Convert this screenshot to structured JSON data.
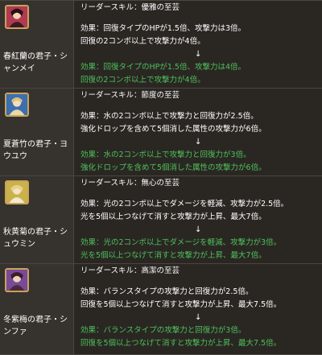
{
  "rows": [
    {
      "name": "春紅蘭の君子・シャンメイ",
      "skill_title": "リーダースキル：優雅の至芸",
      "before": [
        "効果：回復タイプのHPが1.5倍、攻撃力は3倍。",
        "回復の2コンボ以上で攻撃力が4倍。"
      ],
      "arrow": "↓",
      "after": [
        "効果：回復タイプのHPが1.5倍、攻撃力は4倍。",
        "回復の2コンボ以上で攻撃力が4倍。"
      ],
      "icon": "shanmei-portrait-icon",
      "frame_color": "#b03a52"
    },
    {
      "name": "夏蒼竹の君子・ヨウユウ",
      "skill_title": "リーダースキル：節度の至芸",
      "before": [
        "効果：水の2コンボ以上で攻撃力と回復力が2.5倍。",
        "強化ドロップを含めて5個消した属性の攻撃力が6倍。"
      ],
      "arrow": "↓",
      "after": [
        "効果：水の2コンボ以上で攻撃力と回復力が3倍。",
        "強化ドロップを含めて5個消した属性の攻撃力が6倍。"
      ],
      "icon": "youyuu-portrait-icon",
      "frame_color": "#3b6fb0"
    },
    {
      "name": "秋黄菊の君子・シュウミン",
      "skill_title": "リーダースキル：無心の至芸",
      "before": [
        "効果：光の2コンボ以上でダメージを軽減、攻撃力が2.5倍。",
        "光を5個以上つなげて消すと攻撃力が上昇、最大7倍。"
      ],
      "arrow": "↓",
      "after": [
        "効果：光の2コンボ以上でダメージを軽減、攻撃力が3倍。",
        "光を5個以上つなげて消すと攻撃力が上昇、最大7倍。"
      ],
      "icon": "shuumin-portrait-icon",
      "frame_color": "#c9b24a"
    },
    {
      "name": "冬紫梅の君子・シンファ",
      "skill_title": "リーダースキル：高潔の至芸",
      "before": [
        "効果：バランスタイプの攻撃力と回復力が2.5倍。",
        "回復を5個以上つなげて消すと攻撃力が上昇、最大7.5倍。"
      ],
      "arrow": "↓",
      "after": [
        "効果：バランスタイプの攻撃力と回復力が3倍。",
        "回復を5個以上つなげて消すと攻撃力が上昇、最大7.5倍。"
      ],
      "icon": "shinfa-portrait-icon",
      "frame_color": "#7a4a9a"
    }
  ],
  "colors": {
    "text": "#ffffff",
    "highlight": "#4ec05a",
    "left_bg": "#36322d",
    "right_bg": "#2a2723",
    "border": "#4a4540"
  }
}
